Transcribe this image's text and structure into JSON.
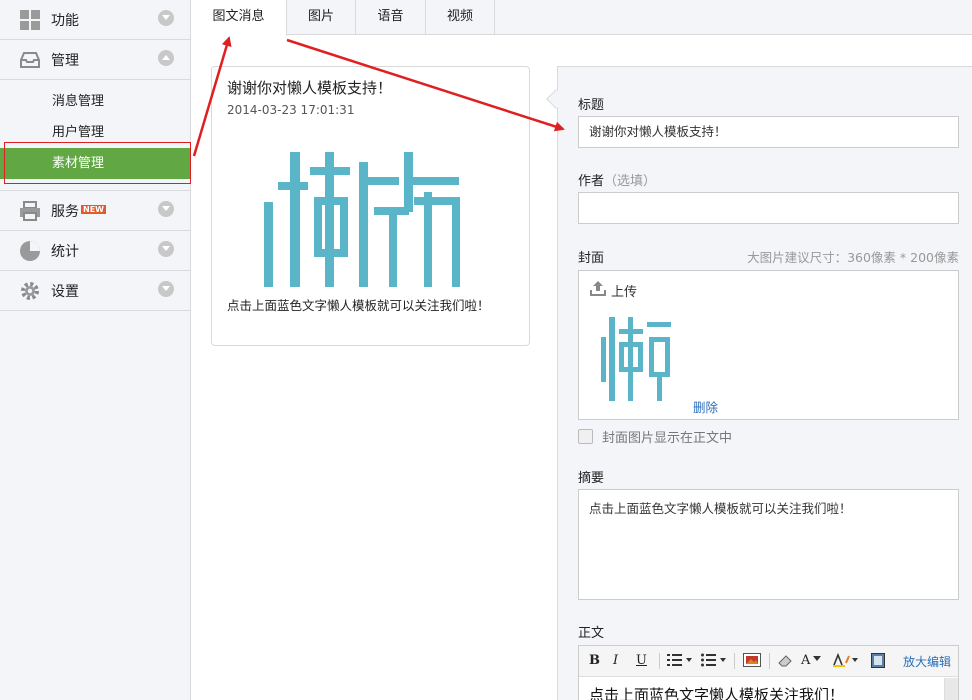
{
  "sidebar": {
    "groups": [
      {
        "label": "功能",
        "icon": "grid-icon"
      },
      {
        "label": "管理",
        "icon": "inbox-icon"
      },
      {
        "label": "服务",
        "icon": "printer-icon",
        "badge": "NEW"
      },
      {
        "label": "统计",
        "icon": "pie-chart-icon"
      },
      {
        "label": "设置",
        "icon": "gear-icon"
      }
    ],
    "sub_items": [
      {
        "label": "消息管理"
      },
      {
        "label": "用户管理"
      },
      {
        "label": "素材管理"
      }
    ]
  },
  "tabs": [
    {
      "label": "图文消息",
      "active": true
    },
    {
      "label": "图片"
    },
    {
      "label": "语音"
    },
    {
      "label": "视频"
    }
  ],
  "preview": {
    "title": "谢谢你对懒人模板支持！",
    "date": "2014-03-23 17:01:31",
    "cover_glyph": "懒",
    "description": "点击上面蓝色文字懒人模板就可以关注我们啦！"
  },
  "editor": {
    "title_label": "标题",
    "title_value": "谢谢你对懒人模板支持！",
    "author_label": "作者",
    "author_optional": "（选填）",
    "author_value": "",
    "cover_label": "封面",
    "cover_hint": "大图片建议尺寸：360像素 * 200像素",
    "upload_label": "上传",
    "delete_label": "删除",
    "show_cover_label": "封面图片显示在正文中",
    "summary_label": "摘要",
    "summary_value": "点击上面蓝色文字懒人模板就可以关注我们啦！",
    "body_label": "正文",
    "zoom_edit_label": "放大编辑",
    "body_value": "点击上面蓝色文字懒人模板关注我们！"
  },
  "toolbar": {
    "bold": "B",
    "italic": "I",
    "underline": "U",
    "font_color": "A"
  },
  "colors": {
    "active_green": "#61a844",
    "brand_teal": "#5bb5c9",
    "annotation_red": "#e02020",
    "link_blue": "#2a6ebb"
  }
}
